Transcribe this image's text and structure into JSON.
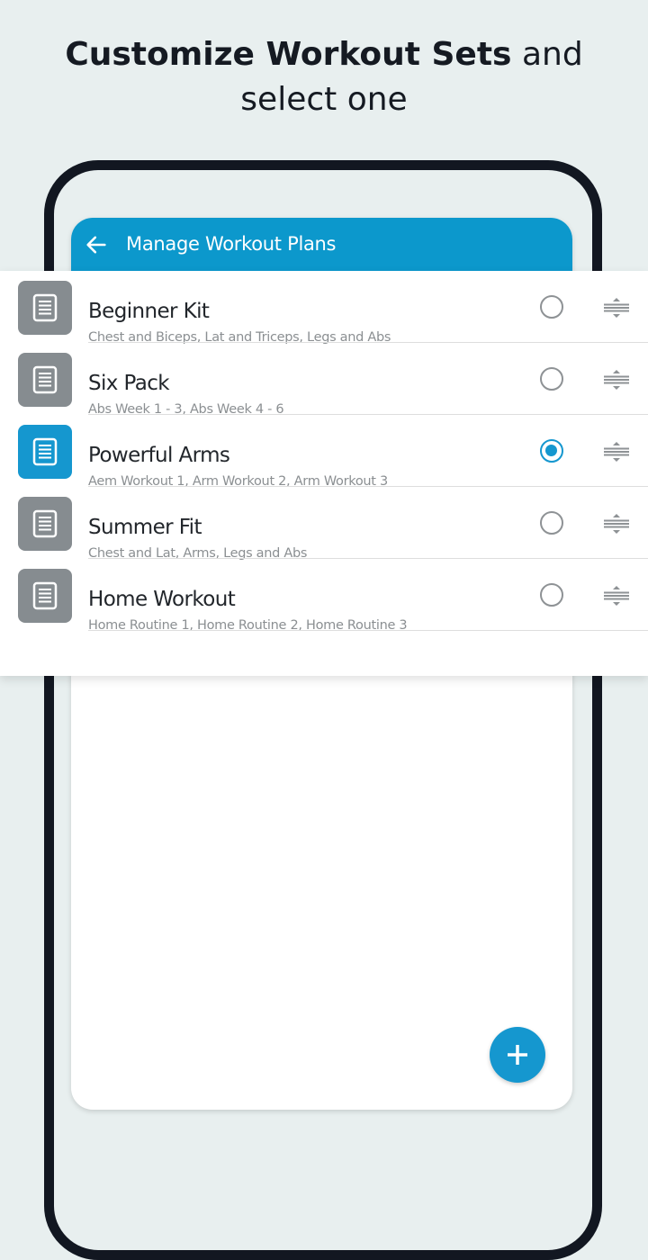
{
  "headline": {
    "bold": "Customize Workout Sets",
    "light_inline": "and",
    "line2": "select one"
  },
  "app": {
    "title": "Manage Workout Plans",
    "back_icon": "arrow-left-icon",
    "fab_icon": "plus-icon"
  },
  "colors": {
    "accent": "#1597cf",
    "appbar": "#0c98cc",
    "thumb_inactive": "#868c90",
    "background": "#e8efef"
  },
  "plans": [
    {
      "title": "Beginner Kit",
      "subtitle": "Chest and Biceps, Lat and Triceps, Legs and Abs",
      "selected": false
    },
    {
      "title": "Six Pack",
      "subtitle": "Abs Week 1 - 3, Abs Week 4 - 6",
      "selected": false
    },
    {
      "title": "Powerful Arms",
      "subtitle": "Aem Workout 1, Arm Workout 2, Arm Workout 3",
      "selected": true
    },
    {
      "title": "Summer Fit",
      "subtitle": "Chest and Lat, Arms, Legs and Abs",
      "selected": false
    },
    {
      "title": "Home Workout",
      "subtitle": "Home Routine 1, Home Routine 2, Home Routine 3",
      "selected": false
    }
  ]
}
